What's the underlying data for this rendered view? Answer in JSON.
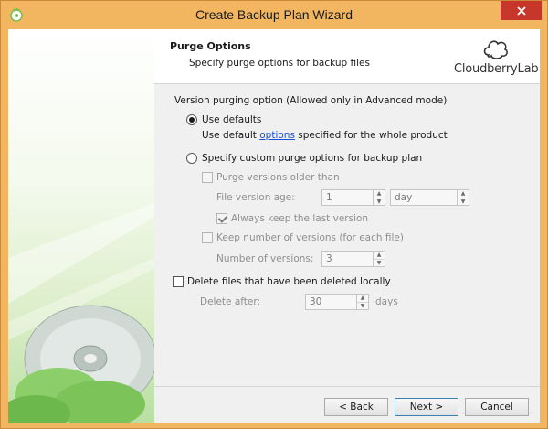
{
  "window": {
    "title": "Create Backup Plan Wizard"
  },
  "header": {
    "title": "Purge Options",
    "subtitle": "Specify purge options for backup files",
    "logo_text": "CloudberryLab"
  },
  "content": {
    "section_label": "Version purging option (Allowed only in Advanced mode)",
    "use_defaults_label": "Use defaults",
    "use_default_prefix": "Use default ",
    "options_link": "options",
    "use_default_suffix": " specified for the whole product",
    "custom_label": "Specify custom purge options for backup plan",
    "purge_older_label": "Purge versions older than",
    "file_age_label": "File version age:",
    "file_age_value": "1",
    "file_age_unit": "day",
    "keep_last_label": "Always keep the last version",
    "keep_number_label": "Keep number of versions (for each file)",
    "number_versions_label": "Number of versions:",
    "number_versions_value": "3",
    "delete_local_label": "Delete files that have been deleted locally",
    "delete_after_label": "Delete after:",
    "delete_after_value": "30",
    "days_label": "days"
  },
  "buttons": {
    "back": "< Back",
    "next": "Next >",
    "cancel": "Cancel"
  },
  "colors": {
    "titlebar": "#f2b660",
    "close": "#c7362b",
    "link": "#1a4fd8"
  }
}
